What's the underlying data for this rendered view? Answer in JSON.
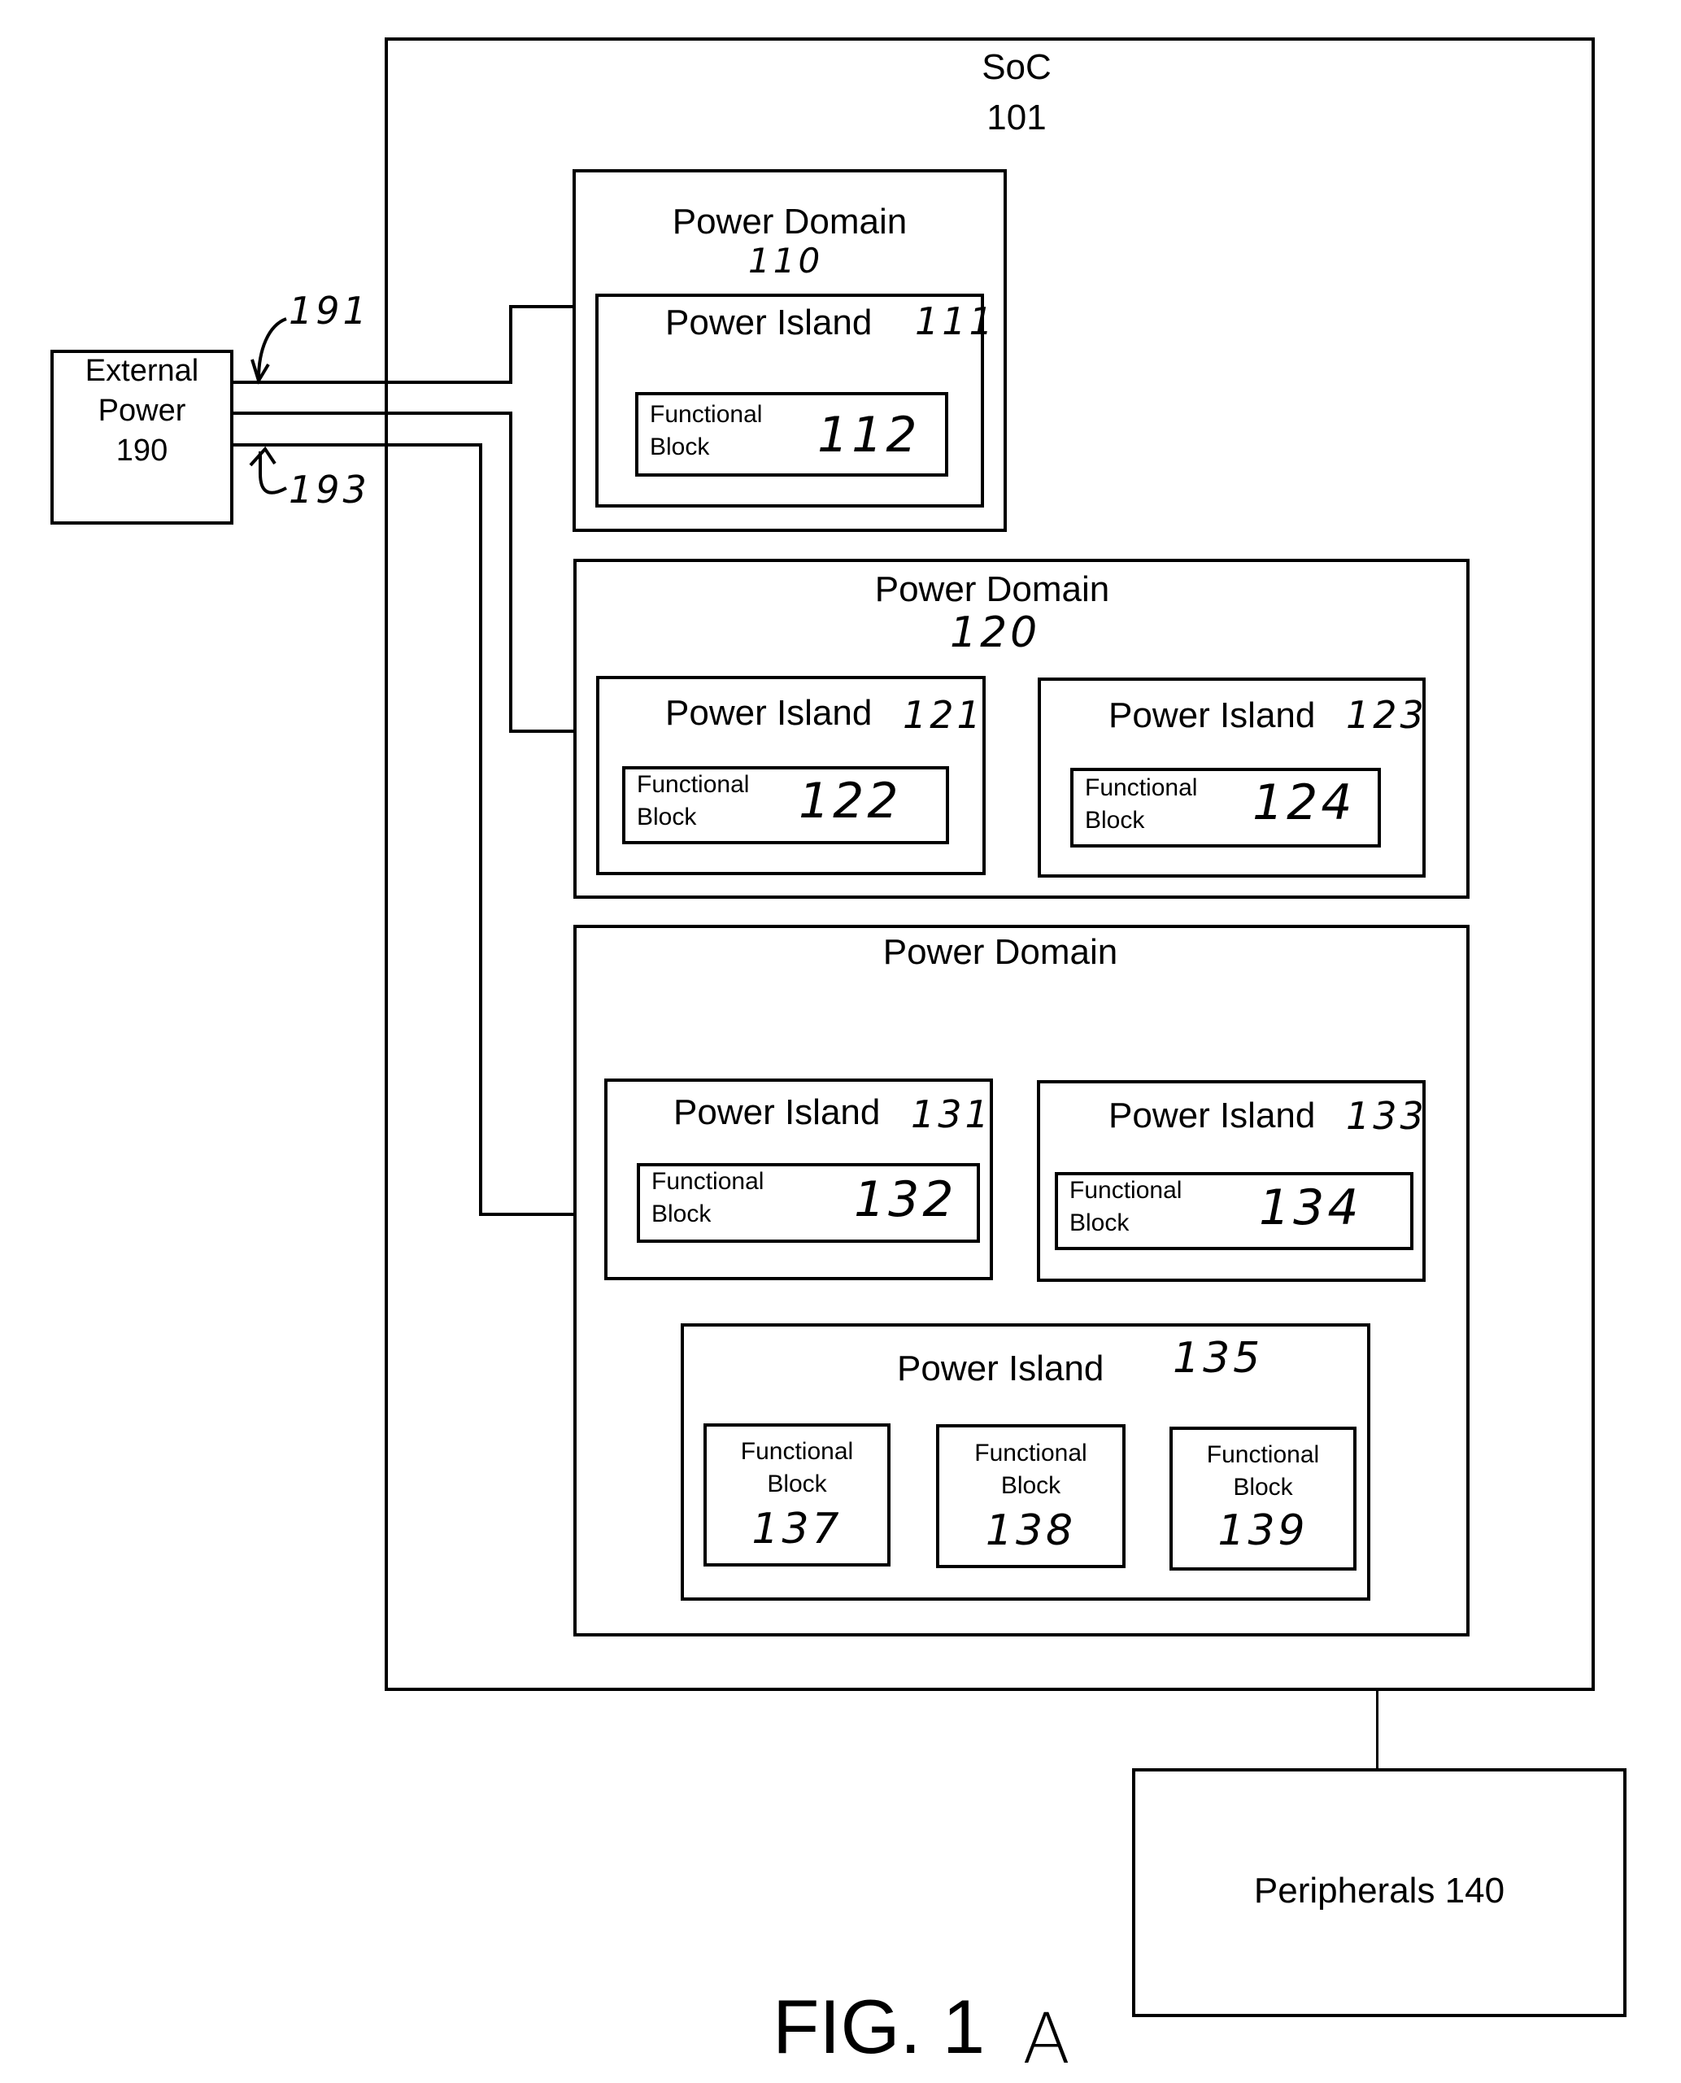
{
  "figure": {
    "caption": "FIG. 1",
    "caption_suffix": "A"
  },
  "external_power": {
    "line1": "External",
    "line2": "Power",
    "number": "190"
  },
  "wire_labels": {
    "top": "191",
    "bottom": "193"
  },
  "soc": {
    "title": "SoC",
    "number": "101"
  },
  "domains": [
    {
      "title": "Power Domain",
      "number": "110",
      "islands": [
        {
          "title": "Power Island",
          "number": "111",
          "blocks": [
            {
              "line1": "Functional",
              "line2": "Block",
              "number": "112"
            }
          ]
        }
      ]
    },
    {
      "title": "Power Domain",
      "number": "120",
      "islands": [
        {
          "title": "Power Island",
          "number": "121",
          "blocks": [
            {
              "line1": "Functional",
              "line2": "Block",
              "number": "122"
            }
          ]
        },
        {
          "title": "Power Island",
          "number": "123",
          "blocks": [
            {
              "line1": "Functional",
              "line2": "Block",
              "number": "124"
            }
          ]
        }
      ]
    },
    {
      "title": "Power Domain",
      "number": "",
      "islands": [
        {
          "title": "Power Island",
          "number": "131",
          "blocks": [
            {
              "line1": "Functional",
              "line2": "Block",
              "number": "132"
            }
          ]
        },
        {
          "title": "Power Island",
          "number": "133",
          "blocks": [
            {
              "line1": "Functional",
              "line2": "Block",
              "number": "134"
            }
          ]
        },
        {
          "title": "Power Island",
          "number": "135",
          "blocks": [
            {
              "line1": "Functional",
              "line2": "Block",
              "number": "137"
            },
            {
              "line1": "Functional",
              "line2": "Block",
              "number": "138"
            },
            {
              "line1": "Functional",
              "line2": "Block",
              "number": "139"
            }
          ]
        }
      ]
    }
  ],
  "peripherals": {
    "label": "Peripherals 140"
  }
}
